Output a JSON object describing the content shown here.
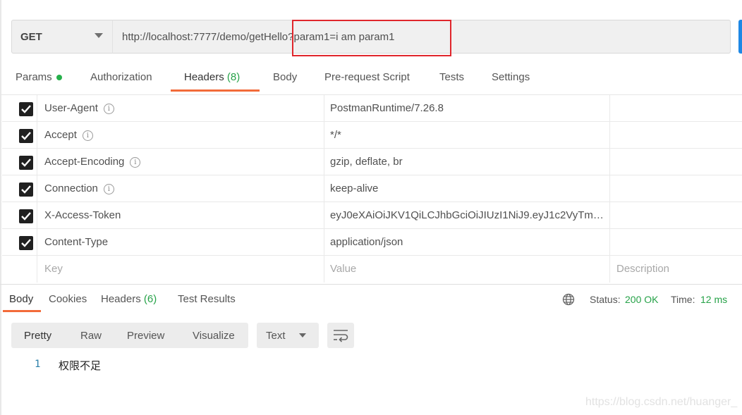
{
  "request": {
    "method": "GET",
    "url": "http://localhost:7777/demo/getHello?param1=i am param1"
  },
  "request_tabs": {
    "params": "Params",
    "authorization": "Authorization",
    "headers": "Headers",
    "headers_count": "(8)",
    "body": "Body",
    "prerequest": "Pre-request Script",
    "tests": "Tests",
    "settings": "Settings"
  },
  "headers_table": {
    "rows": [
      {
        "key": "User-Agent",
        "value": "PostmanRuntime/7.26.8",
        "checked": true,
        "info": true
      },
      {
        "key": "Accept",
        "value": "*/*",
        "checked": true,
        "info": true
      },
      {
        "key": "Accept-Encoding",
        "value": "gzip, deflate, br",
        "checked": true,
        "info": true
      },
      {
        "key": "Connection",
        "value": "keep-alive",
        "checked": true,
        "info": true
      },
      {
        "key": "X-Access-Token",
        "value": "eyJ0eXAiOiJKV1QiLCJhbGciOiJIUzI1NiJ9.eyJ1c2VyTmFtZ...",
        "checked": true,
        "info": false
      },
      {
        "key": "Content-Type",
        "value": "application/json",
        "checked": true,
        "info": false
      }
    ],
    "placeholder_key": "Key",
    "placeholder_value": "Value",
    "placeholder_description": "Description"
  },
  "response_tabs": {
    "body": "Body",
    "cookies": "Cookies",
    "headers": "Headers",
    "headers_count": "(6)",
    "test_results": "Test Results"
  },
  "response_status": {
    "status_label": "Status:",
    "status_value": "200 OK",
    "time_label": "Time:",
    "time_value": "12 ms"
  },
  "response_view": {
    "pretty": "Pretty",
    "raw": "Raw",
    "preview": "Preview",
    "visualize": "Visualize",
    "format": "Text"
  },
  "response_body": {
    "line_number": "1",
    "content": "权限不足"
  },
  "watermark": "https://blog.csdn.net/huanger_",
  "colors": {
    "accent_orange": "#f26b3a",
    "success_green": "#26a248",
    "highlight_red": "#e0262c",
    "send_blue": "#1e88e5"
  }
}
